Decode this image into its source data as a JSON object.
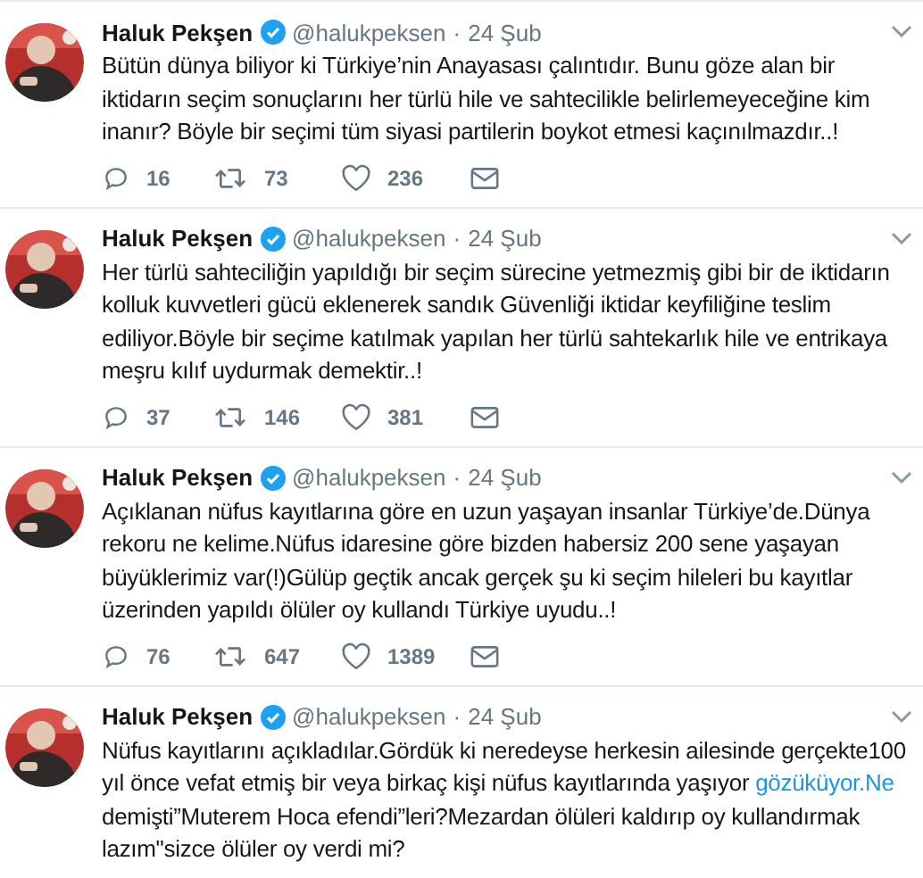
{
  "tweets": [
    {
      "name": "Haluk Pekşen",
      "handle": "@halukpeksen",
      "separator": "·",
      "date": "24 Şub",
      "text": [
        {
          "kind": "text",
          "text": "Bütün dünya biliyor ki Türkiye’nin Anayasası çalıntıdır. Bunu göze alan bir iktidarın seçim sonuçlarını her türlü hile ve sahtecilikle belirlemeyeceğine kim inanır? Böyle bir seçimi tüm siyasi partilerin boykot etmesi kaçınılmazdır..!"
        }
      ],
      "actions": {
        "replies": "16",
        "retweets": "73",
        "likes": "236"
      }
    },
    {
      "name": "Haluk Pekşen",
      "handle": "@halukpeksen",
      "separator": "·",
      "date": "24 Şub",
      "text": [
        {
          "kind": "text",
          "text": "Her türlü sahteciliğin yapıldığı bir seçim sürecine yetmezmiş gibi bir de iktidarın kolluk kuvvetleri gücü eklenerek sandık Güvenliği iktidar keyfiliğine teslim ediliyor.Böyle bir seçime katılmak yapılan her türlü sahtekarlık hile ve entrikaya meşru kılıf uydurmak demektir..!"
        }
      ],
      "actions": {
        "replies": "37",
        "retweets": "146",
        "likes": "381"
      }
    },
    {
      "name": "Haluk Pekşen",
      "handle": "@halukpeksen",
      "separator": "·",
      "date": "24 Şub",
      "text": [
        {
          "kind": "text",
          "text": "Açıklanan nüfus kayıtlarına göre en uzun yaşayan insanlar Türkiye’de.Dünya rekoru ne kelime.Nüfus idaresine göre bizden habersiz 200 sene yaşayan büyüklerimiz var(!)Gülüp geçtik ancak gerçek şu ki seçim hileleri bu kayıtlar üzerinden yapıldı ölüler oy kullandı Türkiye uyudu..!"
        }
      ],
      "actions": {
        "replies": "76",
        "retweets": "647",
        "likes": "1389"
      }
    },
    {
      "name": "Haluk Pekşen",
      "handle": "@halukpeksen",
      "separator": "·",
      "date": "24 Şub",
      "text": [
        {
          "kind": "text",
          "text": "Nüfus kayıtlarını açıkladılar.Gördük ki neredeyse herkesin ailesinde gerçekte100 yıl önce vefat etmiş bir veya birkaç kişi nüfus kayıtlarında yaşıyor "
        },
        {
          "kind": "link",
          "text": "gözüküyor.Ne"
        },
        {
          "kind": "text",
          "text": " demişti”Muterem Hoca efendi”leri?Mezardan ölüleri kaldırıp oy kullandırmak lazım\"sizce ölüler oy verdi mi?"
        }
      ]
    }
  ]
}
